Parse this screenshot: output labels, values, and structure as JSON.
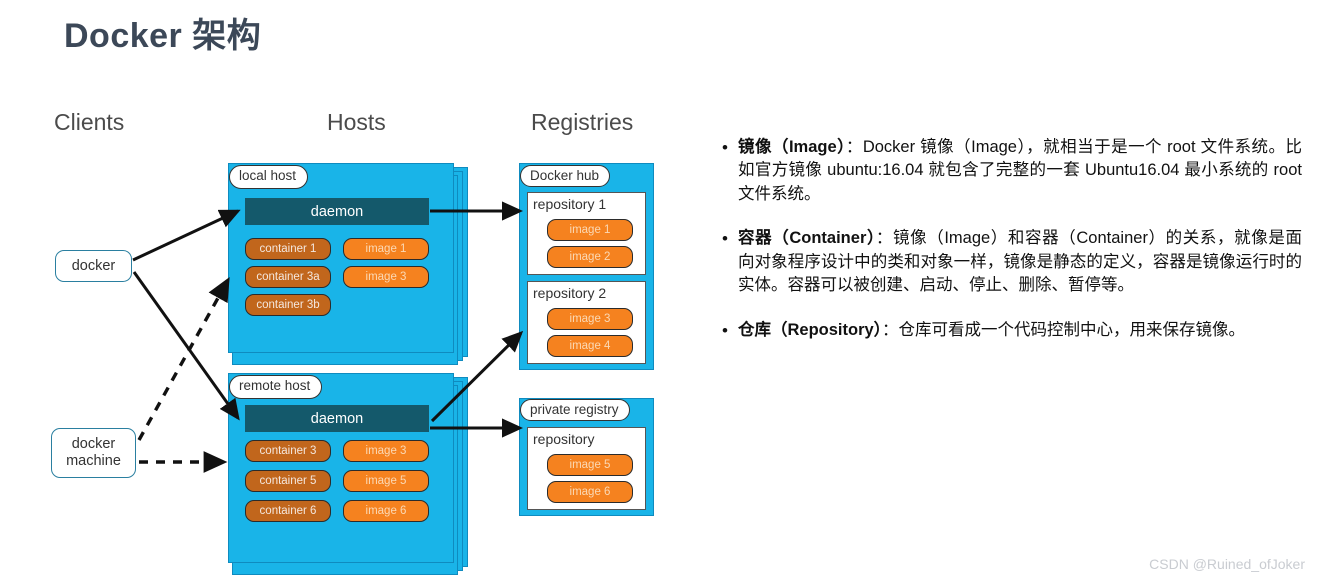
{
  "page_title": "Docker 架构",
  "watermark": "CSDN @Ruined_ofJoker",
  "colors": {
    "title": "#3c4858",
    "host_cyan": "#19b4e8",
    "host_border": "#0f8bbf",
    "daemon": "#14596b",
    "container_pill": "#c1661c",
    "image_pill": "#f5821f",
    "client_border": "#2a7fa0",
    "watermark": "#c9ccd1"
  },
  "diagram": {
    "headers": {
      "clients": "Clients",
      "hosts": "Hosts",
      "registries": "Registries"
    },
    "clients": [
      {
        "label": "docker"
      },
      {
        "label": "docker machine"
      }
    ],
    "hosts": [
      {
        "label": "local host",
        "daemon": "daemon",
        "containers": [
          "container 1",
          "container 3a",
          "container 3b"
        ],
        "images": [
          "image 1",
          "image 3"
        ]
      },
      {
        "label": "remote host",
        "daemon": "daemon",
        "containers": [
          "container 3",
          "container 5",
          "container 6"
        ],
        "images": [
          "image 3",
          "image 5",
          "image 6"
        ]
      }
    ],
    "registries": [
      {
        "label": "Docker hub",
        "repositories": [
          {
            "title": "repository 1",
            "images": [
              "image 1",
              "image 2"
            ]
          },
          {
            "title": "repository 2",
            "images": [
              "image 3",
              "image 4"
            ]
          }
        ]
      },
      {
        "label": "private registry",
        "repositories": [
          {
            "title": "repository",
            "images": [
              "image 5",
              "image 6"
            ]
          }
        ]
      }
    ]
  },
  "text_pane": {
    "bullet_marker": "•",
    "bullets": [
      {
        "term": "镜像（Image）",
        "body": "：Docker 镜像（Image），就相当于是一个 root 文件系统。比如官方镜像 ubuntu:16.04 就包含了完整的一套 Ubuntu16.04 最小系统的 root 文件系统。"
      },
      {
        "term": "容器（Container）",
        "body": "：镜像（Image）和容器（Container）的关系，就像是面向对象程序设计中的类和对象一样，镜像是静态的定义，容器是镜像运行时的实体。容器可以被创建、启动、停止、删除、暂停等。"
      },
      {
        "term": "仓库（Repository）",
        "body": "：仓库可看成一个代码控制中心，用来保存镜像。"
      }
    ]
  }
}
